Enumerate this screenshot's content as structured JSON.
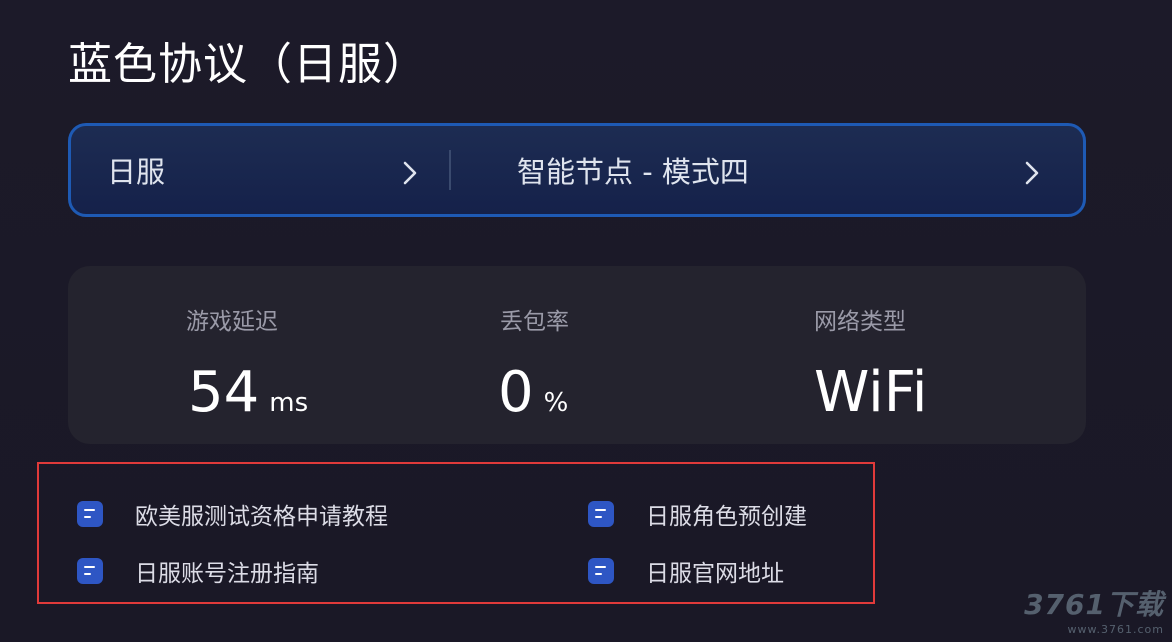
{
  "header": {
    "title": "蓝色协议（日服）"
  },
  "selector": {
    "server": "日服",
    "node": "智能节点 - 模式四"
  },
  "stats": {
    "latency": {
      "label": "游戏延迟",
      "value": "54",
      "unit": "ms"
    },
    "packet_loss": {
      "label": "丢包率",
      "value": "0",
      "unit": "%"
    },
    "network": {
      "label": "网络类型",
      "value": "WiFi"
    }
  },
  "links": [
    {
      "label": "欧美服测试资格申请教程",
      "icon": "document-icon"
    },
    {
      "label": "日服角色预创建",
      "icon": "document-icon"
    },
    {
      "label": "日服账号注册指南",
      "icon": "document-icon"
    },
    {
      "label": "日服官网地址",
      "icon": "document-icon"
    }
  ],
  "watermark": {
    "main": "3761下载",
    "sub": "www.3761.com"
  },
  "colors": {
    "background": "#1a1826",
    "selector_border": "#1e5ab4",
    "selector_fill": "#15214a",
    "stats_panel": "#24232e",
    "link_icon": "#2e56c4",
    "highlight_box": "#e03a3a"
  }
}
